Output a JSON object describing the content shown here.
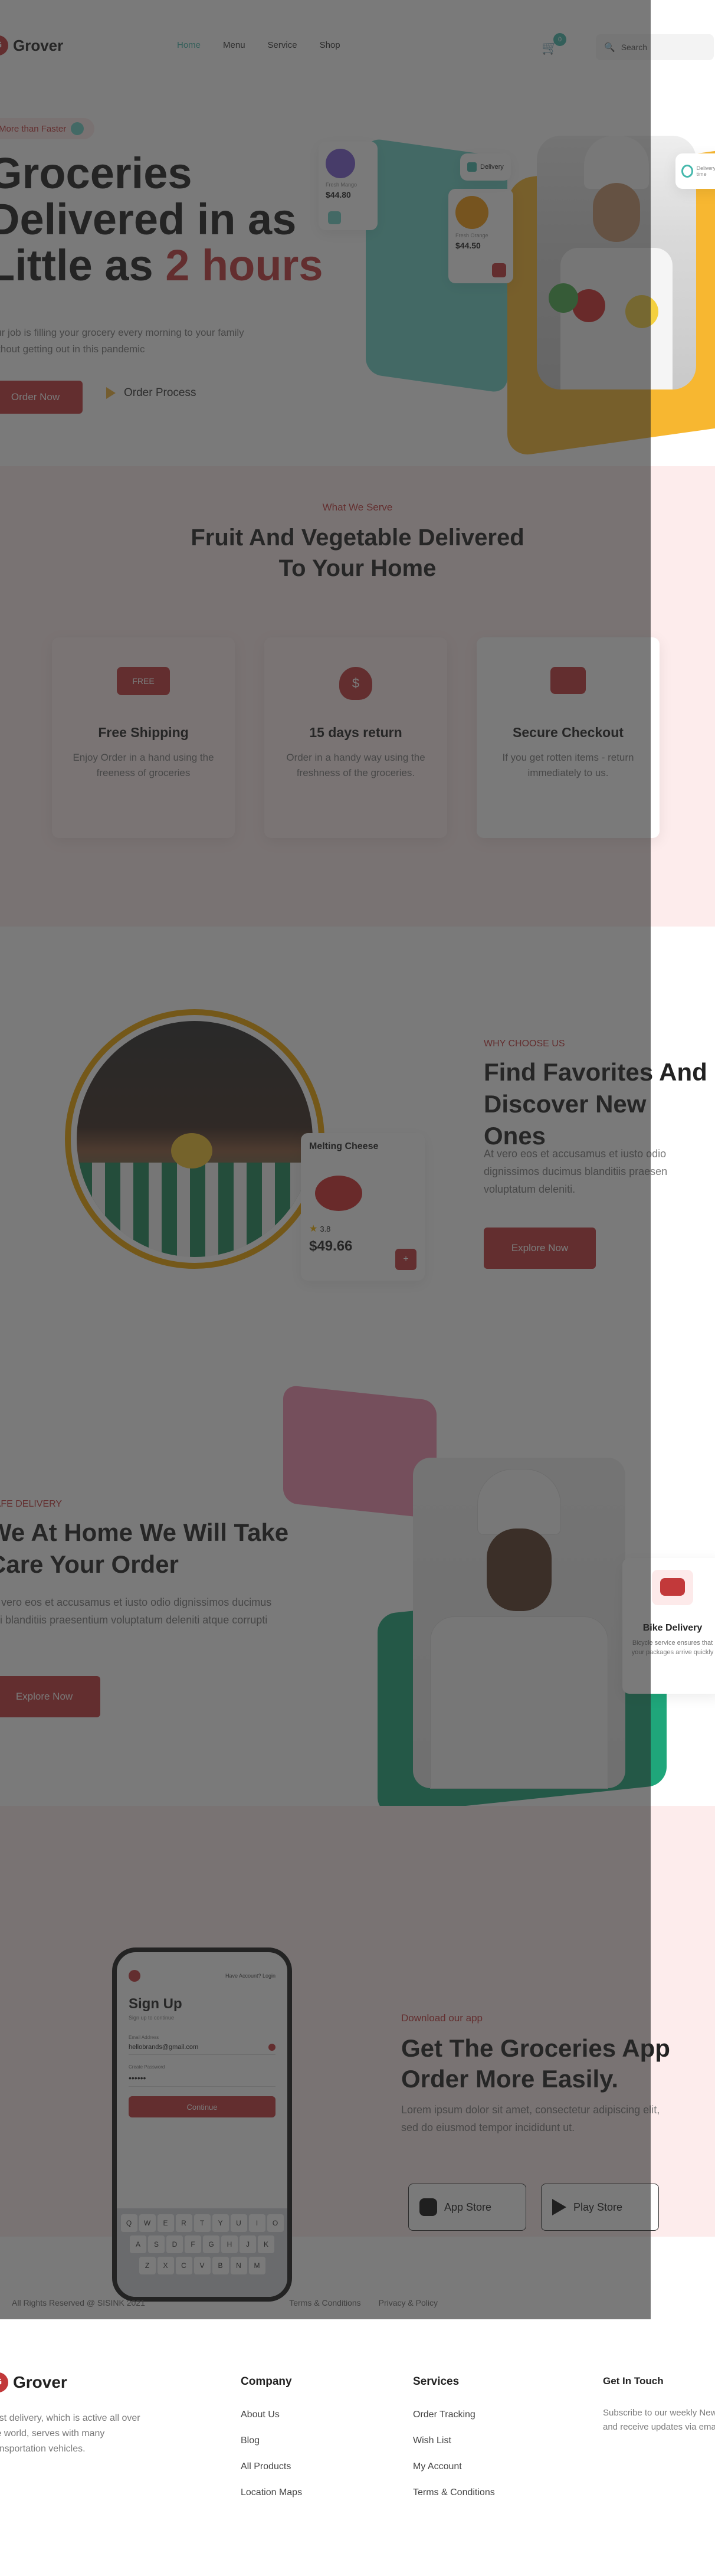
{
  "brand": {
    "name": "Grover",
    "color": "#c2393a",
    "accent": "#45b8ac"
  },
  "header": {
    "nav": [
      "Home",
      "Menu",
      "Service",
      "Shop"
    ],
    "cart_count": "0",
    "search_placeholder": "Search"
  },
  "hero": {
    "badge": "More than Faster",
    "title_line1": "Groceries",
    "title_line2": "Delivered in as",
    "title_line3a": "Little as ",
    "title_line3b": "2 hours",
    "subtitle_line1": "Our job is filling your grocery every morning to your family",
    "subtitle_line2": "without getting out in this pandemic",
    "order_now": "Order Now",
    "order_process": "Order Process",
    "product_card1": {
      "name": "Fresh Mango",
      "price": "$44.80"
    },
    "product_card2": {
      "name": "Fresh Orange",
      "price": "$44.50"
    },
    "delivery_label": "Delivery",
    "timer_label": "Delivery time"
  },
  "features": {
    "eyebrow": "What We Serve",
    "title_line1": "Fruit And Vegetable Delivered",
    "title_line2": "To Your Home",
    "items": [
      {
        "icon": "truck-icon",
        "title": "Free Shipping",
        "text_line1": "Enjoy Order in a hand using the",
        "text_line2": "freeness of groceries"
      },
      {
        "icon": "money-bag-icon",
        "title": "15 days return",
        "text_line1": "Order in a handy way using the",
        "text_line2": "freshness of the groceries."
      },
      {
        "icon": "chat-icon",
        "title": "Secure Checkout",
        "text_line1": "If you get rotten items - return",
        "text_line2": "immediately to us."
      }
    ]
  },
  "favorites": {
    "eyebrow": "WHY CHOOSE US",
    "title_line1": "Find Favorites And",
    "title_line2": "Discover New Ones",
    "text_line1": "At vero eos et accusamus et iusto odio",
    "text_line2": "dignissimos ducimus blanditiis praesen",
    "text_line3": "voluptatum deleniti.",
    "button": "Explore Now",
    "card": {
      "name": "Melting Cheese",
      "rating": "3.8",
      "price": "$49.66"
    }
  },
  "secure": {
    "eyebrow": "SAFE DELIVERY",
    "title_line1": "We At Home We Will Take",
    "title_line2": "Care Your Order",
    "text_line1": "At vero eos et accusamus et iusto odio dignissimos ducimus",
    "text_line2": "qui blanditiis praesentium voluptatum deleniti atque corrupti",
    "button": "Explore Now",
    "bike_card": {
      "title": "Bike Delivery",
      "text": "Bicycle service ensures that your packages arrive quickly"
    }
  },
  "app": {
    "eyebrow": "Download our app",
    "title_line1": "Get The Groceries App",
    "title_line2": "Order More Easily.",
    "text_line1": "Lorem ipsum dolor sit amet, consectetur adipiscing elit,",
    "text_line2": "sed do eiusmod tempor incididunt ut.",
    "app_store": "App Store",
    "play_store": "Play Store",
    "phone": {
      "top_link": "Have Account? Login",
      "title": "Sign Up",
      "subtitle": "Sign up to continue",
      "email_label": "Email Address",
      "email_value": "hellobrands@gmail.com",
      "password_label": "Create Password",
      "password_value": "••••••",
      "button": "Continue",
      "kb_row1": [
        "Q",
        "W",
        "E",
        "R",
        "T",
        "Y",
        "U",
        "I",
        "O",
        "P"
      ],
      "kb_row2": [
        "A",
        "S",
        "D",
        "F",
        "G",
        "H",
        "J",
        "K",
        "L"
      ],
      "kb_row3": [
        "Z",
        "X",
        "C",
        "V",
        "B",
        "N",
        "M"
      ]
    }
  },
  "footer": {
    "about_line1": "Fast delivery, which is active all over",
    "about_line2": "the world, serves with many",
    "about_line3": "transportation vehicles.",
    "company_title": "Company",
    "company_links": [
      "About Us",
      "Blog",
      "All Products",
      "Location Maps"
    ],
    "services_title": "Services",
    "services_links": [
      "Order Tracking",
      "Wish List",
      "My Account",
      "Terms & Conditions"
    ],
    "touch_title": "Get In Touch",
    "touch_line1": "Subscribe to our weekly Newsletter",
    "touch_line2": "and receive updates via email.",
    "copyright": "All Rights Reserved @ SISINK 2021",
    "terms": "Terms & Conditions",
    "privacy": "Privacy & Policy"
  }
}
